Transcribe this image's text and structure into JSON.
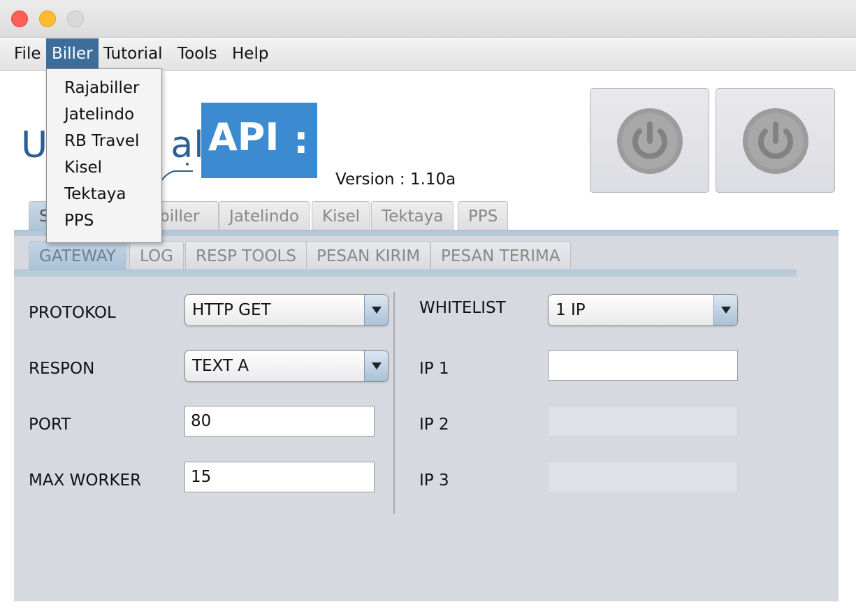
{
  "menubar": {
    "items": [
      {
        "label": "File"
      },
      {
        "label": "Biller"
      },
      {
        "label": "Tutorial"
      },
      {
        "label": "Tools"
      },
      {
        "label": "Help"
      }
    ]
  },
  "biller_menu": {
    "items": [
      {
        "label": "Rajabiller"
      },
      {
        "label": "Jatelindo"
      },
      {
        "label": "RB Travel"
      },
      {
        "label": "Kisel"
      },
      {
        "label": "Tektaya"
      },
      {
        "label": "PPS"
      }
    ]
  },
  "logo": {
    "text_visible": "U          al",
    "api": "API",
    "dots": ":"
  },
  "version": "Version : 1.10a",
  "main_tabs": [
    {
      "label": "S"
    },
    {
      "label": "abiller"
    },
    {
      "label": "Jatelindo"
    },
    {
      "label": "Kisel"
    },
    {
      "label": "Tektaya"
    },
    {
      "label": "PPS"
    }
  ],
  "sub_tabs": [
    {
      "label": "GATEWAY"
    },
    {
      "label": "LOG"
    },
    {
      "label": "RESP TOOLS"
    },
    {
      "label": "PESAN KIRIM"
    },
    {
      "label": "PESAN TERIMA"
    }
  ],
  "gateway": {
    "protokol_label": "PROTOKOL",
    "protokol_value": "HTTP GET",
    "respon_label": "RESPON",
    "respon_value": "TEXT A",
    "port_label": "PORT",
    "port_value": "80",
    "max_worker_label": "MAX WORKER",
    "max_worker_value": "15",
    "whitelist_label": "WHITELIST",
    "whitelist_value": "1 IP",
    "ip1_label": "IP 1",
    "ip1_value": "",
    "ip2_label": "IP 2",
    "ip2_value": "",
    "ip3_label": "IP 3",
    "ip3_value": ""
  },
  "colors": {
    "menu_active": "#3d6d99",
    "logo_blue": "#3c8bd0",
    "content_bg": "#d6d9e0"
  }
}
